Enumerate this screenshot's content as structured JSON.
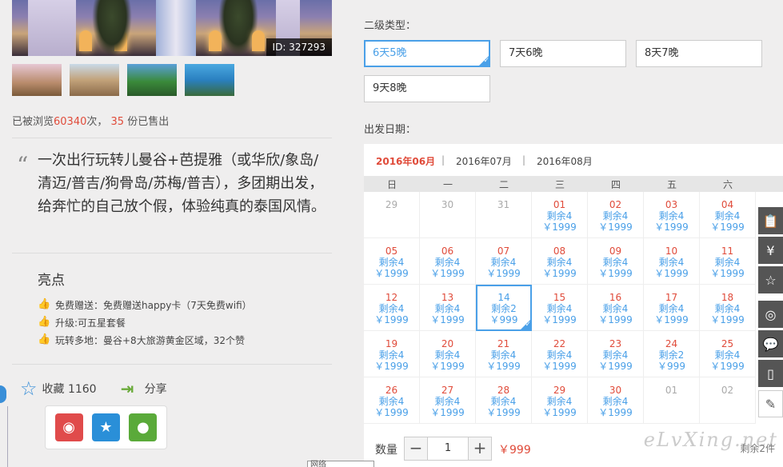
{
  "product": {
    "id_label": "ID: 327293",
    "stats": {
      "prefix": "已被浏览",
      "views": "60340",
      "mid": "次，",
      "sold": "35",
      "suffix": "份已售出"
    },
    "intro": "一次出行玩转儿曼谷+芭提雅（或华欣/象岛/清迈/普吉/狗骨岛/苏梅/普吉），多团期出发，给奔忙的自己放个假，体验纯真的泰国风情。",
    "highlights_title": "亮点",
    "highlights": [
      "免费赠送：免费赠送happy卡（7天免费wifi）",
      "升级:可五星套餐",
      "玩转多地：曼谷+8大旅游黄金区域，32个赞"
    ],
    "favorite_label": "收藏 1160",
    "share_label": "分享"
  },
  "booking": {
    "type_label": "二级类型：",
    "types": [
      "6天5晚",
      "7天6晚",
      "8天7晚",
      "9天8晚"
    ],
    "selected_type": "6天5晚",
    "date_label": "出发日期：",
    "months": [
      "2016年06月",
      "2016年07月",
      "2016年08月"
    ],
    "month_sep": "|",
    "weekdays": [
      "日",
      "一",
      "二",
      "三",
      "四",
      "五",
      "六"
    ],
    "calendar": [
      [
        {
          "d": "29",
          "r": "",
          "p": ""
        },
        {
          "d": "30",
          "r": "",
          "p": ""
        },
        {
          "d": "31",
          "r": "",
          "p": ""
        },
        {
          "d": "01",
          "r": "剩余4",
          "p": "￥1999"
        },
        {
          "d": "02",
          "r": "剩余4",
          "p": "￥1999"
        },
        {
          "d": "03",
          "r": "剩余4",
          "p": "￥1999"
        },
        {
          "d": "04",
          "r": "剩余4",
          "p": "￥1999"
        }
      ],
      [
        {
          "d": "05",
          "r": "剩余4",
          "p": "￥1999"
        },
        {
          "d": "06",
          "r": "剩余4",
          "p": "￥1999"
        },
        {
          "d": "07",
          "r": "剩余4",
          "p": "￥1999"
        },
        {
          "d": "08",
          "r": "剩余4",
          "p": "￥1999"
        },
        {
          "d": "09",
          "r": "剩余4",
          "p": "￥1999"
        },
        {
          "d": "10",
          "r": "剩余4",
          "p": "￥1999"
        },
        {
          "d": "11",
          "r": "剩余4",
          "p": "￥1999"
        }
      ],
      [
        {
          "d": "12",
          "r": "剩余4",
          "p": "￥1999"
        },
        {
          "d": "13",
          "r": "剩余4",
          "p": "￥1999"
        },
        {
          "d": "14",
          "r": "剩余2",
          "p": "￥999"
        },
        {
          "d": "15",
          "r": "剩余4",
          "p": "￥1999"
        },
        {
          "d": "16",
          "r": "剩余4",
          "p": "￥1999"
        },
        {
          "d": "17",
          "r": "剩余4",
          "p": "￥1999"
        },
        {
          "d": "18",
          "r": "剩余4",
          "p": "￥1999"
        }
      ],
      [
        {
          "d": "19",
          "r": "剩余4",
          "p": "￥1999"
        },
        {
          "d": "20",
          "r": "剩余4",
          "p": "￥1999"
        },
        {
          "d": "21",
          "r": "剩余4",
          "p": "￥1999"
        },
        {
          "d": "22",
          "r": "剩余4",
          "p": "￥1999"
        },
        {
          "d": "23",
          "r": "剩余4",
          "p": "￥1999"
        },
        {
          "d": "24",
          "r": "剩余2",
          "p": "￥999"
        },
        {
          "d": "25",
          "r": "剩余4",
          "p": "￥1999"
        }
      ],
      [
        {
          "d": "26",
          "r": "剩余4",
          "p": "￥1999"
        },
        {
          "d": "27",
          "r": "剩余4",
          "p": "￥1999"
        },
        {
          "d": "28",
          "r": "剩余4",
          "p": "￥1999"
        },
        {
          "d": "29",
          "r": "剩余4",
          "p": "￥1999"
        },
        {
          "d": "30",
          "r": "剩余4",
          "p": "￥1999"
        },
        {
          "d": "01",
          "r": "",
          "p": ""
        },
        {
          "d": "02",
          "r": "",
          "p": ""
        }
      ]
    ],
    "selected_date": "14",
    "qty_label": "数量",
    "qty_minus": "−",
    "qty_value": "1",
    "qty_plus": "+",
    "qty_price": "￥999",
    "remain_text": "剩余2件",
    "watermark": "eLvXing.net",
    "dropdown_text": "网络"
  },
  "toolbar": [
    "clipboard-icon",
    "yen-icon",
    "star-icon",
    "weibo-icon",
    "wechat-icon",
    "mobile-icon",
    "pencil-icon"
  ],
  "colors": {
    "accent": "#4aa0e8",
    "price_red": "#e04b3a",
    "highlight": "#f0a030"
  }
}
